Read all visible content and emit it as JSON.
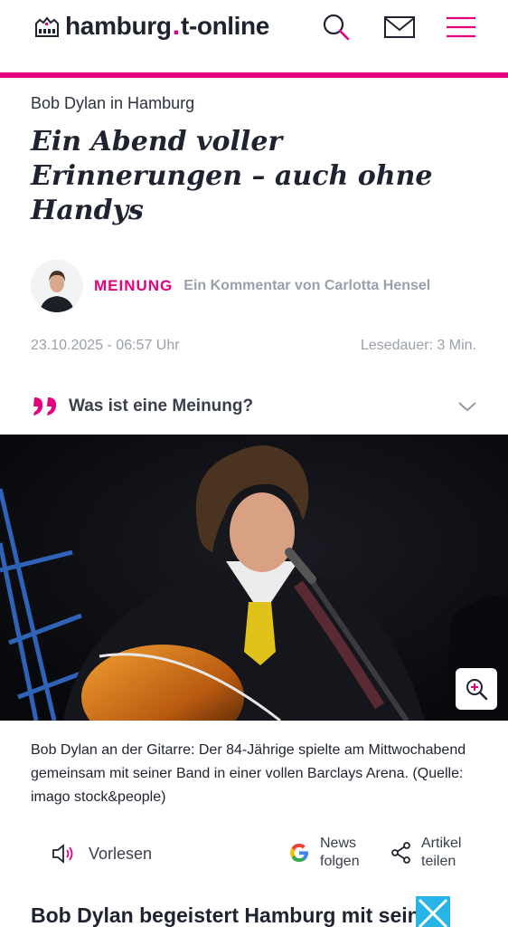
{
  "header": {
    "logo_city": "hamburg",
    "logo_dot": ".",
    "logo_brand": "t-online",
    "accent_color": "#e5007d",
    "icons": [
      "search-icon",
      "mail-icon",
      "menu-icon"
    ]
  },
  "article": {
    "kicker": "Bob Dylan in Hamburg",
    "headline": "Ein Abend voller Erinnerungen – auch ohne Handys",
    "opinion_label": "MEINUNG",
    "author_text": "Ein Kommentar von Carlotta Hensel",
    "date": "23.10.2025 - 06:57 Uhr",
    "reading_time": "Lesedauer: 3 Min.",
    "opinion_question": "Was ist eine Meinung?",
    "caption": "Bob Dylan an der Gitarre: Der 84-Jährige spielte am Mittwochabend gemeinsam mit seiner Band in einer vollen Barclays Arena. (Quelle: imago stock&people)",
    "next_heading": "Bob Dylan begeistert Hamburg mit seiner"
  },
  "actions": {
    "read_aloud": "Vorlesen",
    "news_follow_1": "News",
    "news_follow_2": "folgen",
    "share_1": "Artikel",
    "share_2": "teilen"
  }
}
